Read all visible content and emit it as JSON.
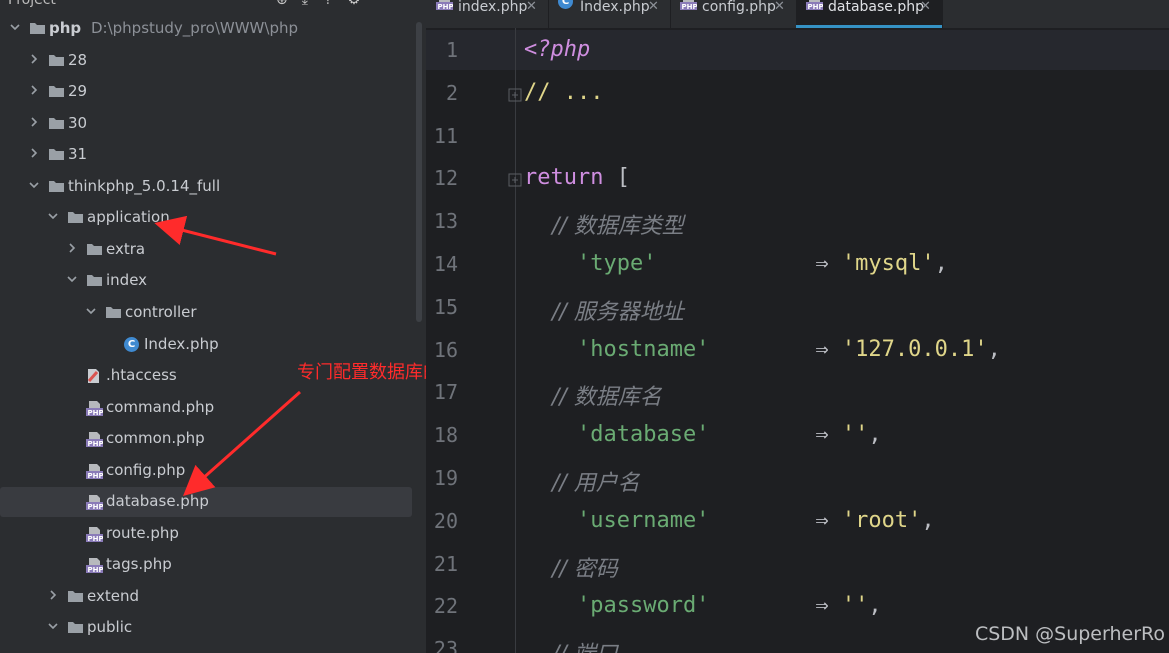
{
  "sidebar": {
    "header": "Project",
    "items": [
      {
        "label": "php",
        "path": "D:\\phpstudy_pro\\WWW\\php",
        "type": "folder",
        "depth": 0,
        "expanded": true
      },
      {
        "label": "28",
        "type": "folder",
        "depth": 1,
        "expanded": false
      },
      {
        "label": "29",
        "type": "folder",
        "depth": 1,
        "expanded": false
      },
      {
        "label": "30",
        "type": "folder",
        "depth": 1,
        "expanded": false
      },
      {
        "label": "31",
        "type": "folder",
        "depth": 1,
        "expanded": false
      },
      {
        "label": "thinkphp_5.0.14_full",
        "type": "folder",
        "depth": 1,
        "expanded": true
      },
      {
        "label": "application",
        "type": "folder",
        "depth": 2,
        "expanded": true
      },
      {
        "label": "extra",
        "type": "folder",
        "depth": 3,
        "expanded": false
      },
      {
        "label": "index",
        "type": "folder",
        "depth": 3,
        "expanded": true
      },
      {
        "label": "controller",
        "type": "folder",
        "depth": 4,
        "expanded": true
      },
      {
        "label": "Index.php",
        "type": "class",
        "depth": 5
      },
      {
        "label": ".htaccess",
        "type": "htaccess",
        "depth": 3
      },
      {
        "label": "command.php",
        "type": "php",
        "depth": 3
      },
      {
        "label": "common.php",
        "type": "php",
        "depth": 3
      },
      {
        "label": "config.php",
        "type": "php",
        "depth": 3
      },
      {
        "label": "database.php",
        "type": "php",
        "depth": 3,
        "selected": true
      },
      {
        "label": "route.php",
        "type": "php",
        "depth": 3
      },
      {
        "label": "tags.php",
        "type": "php",
        "depth": 3
      },
      {
        "label": "extend",
        "type": "folder",
        "depth": 2,
        "expanded": false
      },
      {
        "label": "public",
        "type": "folder",
        "depth": 2,
        "expanded": true
      }
    ],
    "annotation": "专门配置数据库的",
    "annotation_color": "#ff2b2b"
  },
  "tabs": [
    {
      "label": "index.php",
      "icon": "php-file-icon"
    },
    {
      "label": "Index.php",
      "icon": "class-file-icon"
    },
    {
      "label": "config.php",
      "icon": "php-file-icon"
    },
    {
      "label": "database.php",
      "icon": "php-file-icon",
      "active": true
    }
  ],
  "code_lines": [
    {
      "ln": "1",
      "parts": [
        {
          "t": "<?php",
          "c": "kw"
        }
      ]
    },
    {
      "ln": "2",
      "parts": [
        {
          "t": "// ...",
          "c": "str2"
        }
      ],
      "fold": true
    },
    {
      "ln": "11",
      "parts": []
    },
    {
      "ln": "12",
      "parts": [
        {
          "t": "return",
          "c": "ret"
        },
        {
          "t": " [",
          "c": ""
        }
      ],
      "fold": true
    },
    {
      "ln": "13",
      "parts": [
        {
          "t": "    // 数据库类型",
          "c": "cmt"
        }
      ]
    },
    {
      "ln": "14",
      "parts": [
        {
          "t": "    'type'",
          "c": "str"
        },
        {
          "t": "            ⇒ ",
          "c": "arrow-op"
        },
        {
          "t": "'mysql'",
          "c": "str2"
        },
        {
          "t": ",",
          "c": ""
        }
      ]
    },
    {
      "ln": "15",
      "parts": [
        {
          "t": "    // 服务器地址",
          "c": "cmt"
        }
      ]
    },
    {
      "ln": "16",
      "parts": [
        {
          "t": "    'hostname'",
          "c": "str"
        },
        {
          "t": "        ⇒ ",
          "c": "arrow-op"
        },
        {
          "t": "'127.0.0.1'",
          "c": "str2"
        },
        {
          "t": ",",
          "c": ""
        }
      ]
    },
    {
      "ln": "17",
      "parts": [
        {
          "t": "    // 数据库名",
          "c": "cmt"
        }
      ]
    },
    {
      "ln": "18",
      "parts": [
        {
          "t": "    'database'",
          "c": "str"
        },
        {
          "t": "        ⇒ ",
          "c": "arrow-op"
        },
        {
          "t": "''",
          "c": "str2"
        },
        {
          "t": ",",
          "c": ""
        }
      ]
    },
    {
      "ln": "19",
      "parts": [
        {
          "t": "    // 用户名",
          "c": "cmt"
        }
      ]
    },
    {
      "ln": "20",
      "parts": [
        {
          "t": "    'username'",
          "c": "str"
        },
        {
          "t": "        ⇒ ",
          "c": "arrow-op"
        },
        {
          "t": "'root'",
          "c": "str2"
        },
        {
          "t": ",",
          "c": ""
        }
      ]
    },
    {
      "ln": "21",
      "parts": [
        {
          "t": "    // 密码",
          "c": "cmt"
        }
      ]
    },
    {
      "ln": "22",
      "parts": [
        {
          "t": "    'password'",
          "c": "str"
        },
        {
          "t": "        ⇒ ",
          "c": "arrow-op"
        },
        {
          "t": "''",
          "c": "str2"
        },
        {
          "t": ",",
          "c": ""
        }
      ]
    },
    {
      "ln": "23",
      "parts": [
        {
          "t": "    // 端口",
          "c": "cmt"
        }
      ]
    }
  ],
  "watermark": "CSDN @SuperherRo"
}
